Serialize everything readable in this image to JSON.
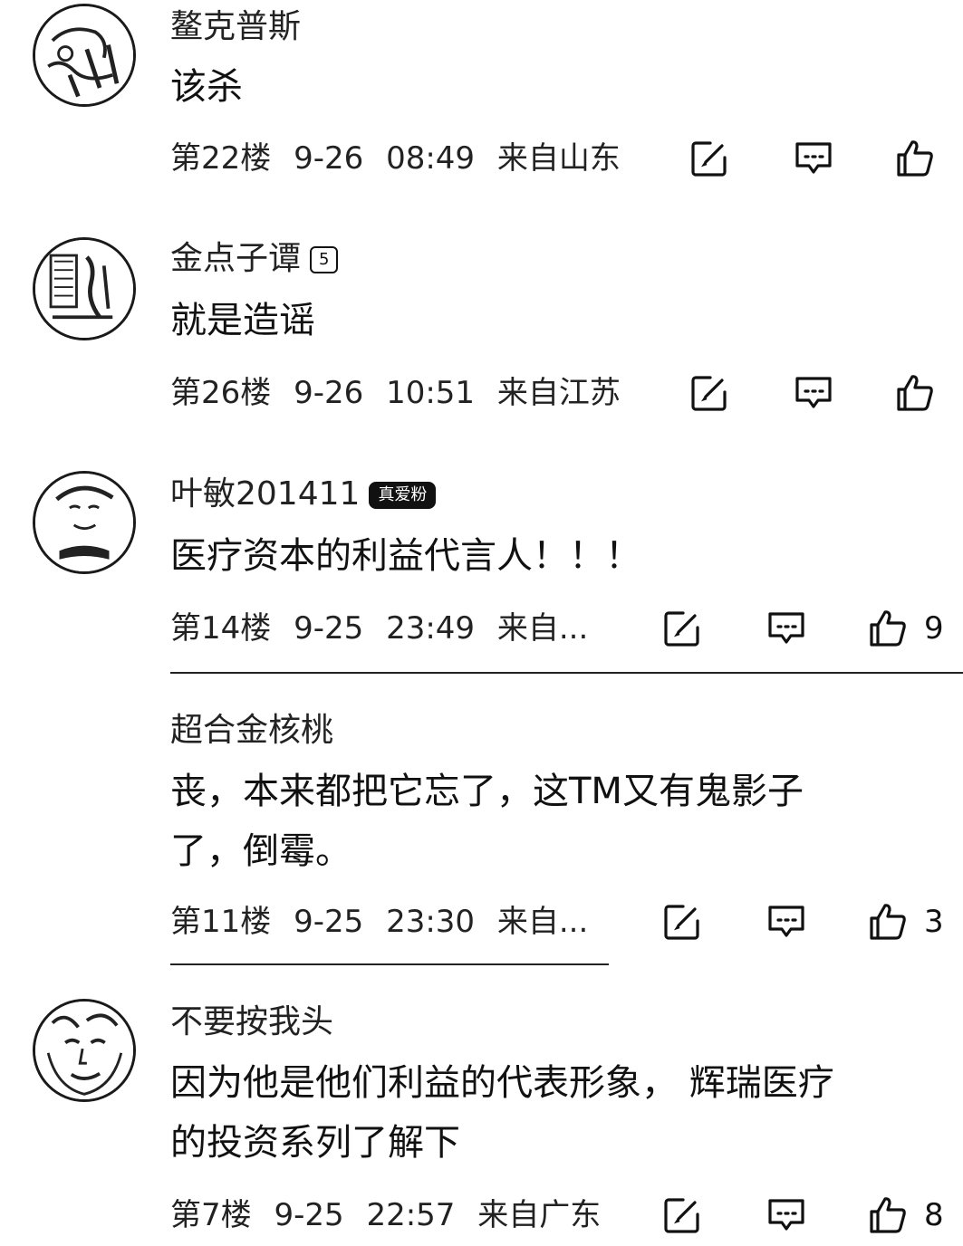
{
  "comments": [
    {
      "name": "鳌克普斯",
      "text": "该杀",
      "floor": "第22楼",
      "date": "9-26",
      "time": "08:49",
      "location": "来自山东"
    },
    {
      "name": "金点子谭",
      "badge": "5",
      "text": "就是造谣",
      "floor": "第26楼",
      "date": "9-26",
      "time": "10:51",
      "location": "来自江苏"
    },
    {
      "name": "叶敏201411",
      "badge": "真爱粉",
      "text": "医疗资本的利益代言人！！！",
      "floor": "第14楼",
      "date": "9-25",
      "time": "23:49",
      "location": "来自...",
      "likes": "9"
    },
    {
      "name": "超合金核桃",
      "text_line1": "丧，本来都把它忘了，这TM又有鬼影子",
      "text_line2": "了，倒霉。",
      "floor": "第11楼",
      "date": "9-25",
      "time": "23:30",
      "location": "来自...",
      "likes": "3"
    },
    {
      "name": "不要按我头",
      "text_line1": "因为他是他们利益的代表形象， 辉瑞医疗",
      "text_line2": "的投资系列了解下",
      "floor": "第7楼",
      "date": "9-25",
      "time": "22:57",
      "location": "来自广东",
      "likes": "8"
    }
  ],
  "icons": {
    "edit": "edit-icon",
    "reply": "comment-icon",
    "like": "thumbs-up-icon"
  }
}
